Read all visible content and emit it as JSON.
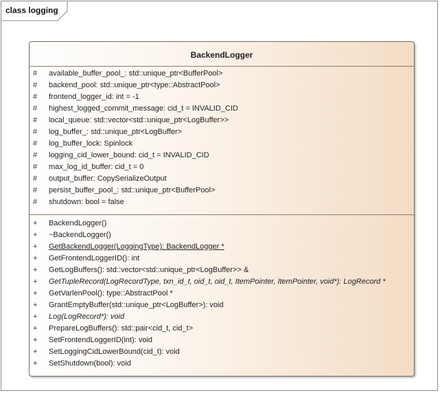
{
  "frame": {
    "title": "class logging"
  },
  "class_box": {
    "name": "BackendLogger",
    "attributes": [
      {
        "vis": "#",
        "text": "available_buffer_pool_: std::unique_ptr<BufferPool>"
      },
      {
        "vis": "#",
        "text": "backend_pool: std::unique_ptr<type::AbstractPool>"
      },
      {
        "vis": "#",
        "text": "frontend_logger_id: int = -1"
      },
      {
        "vis": "#",
        "text": "highest_logged_commit_message: cid_t = INVALID_CID"
      },
      {
        "vis": "#",
        "text": "local_queue: std::vector<std::unique_ptr<LogBuffer>>"
      },
      {
        "vis": "#",
        "text": "log_buffer_: std::unique_ptr<LogBuffer>"
      },
      {
        "vis": "#",
        "text": "log_buffer_lock: Spinlock"
      },
      {
        "vis": "#",
        "text": "logging_cid_lower_bound: cid_t = INVALID_CID"
      },
      {
        "vis": "#",
        "text": "max_log_id_buffer: cid_t = 0"
      },
      {
        "vis": "#",
        "text": "output_buffer: CopySerializeOutput"
      },
      {
        "vis": "#",
        "text": "persist_buffer_pool_: std::unique_ptr<BufferPool>"
      },
      {
        "vis": "#",
        "text": "shutdown: bool = false"
      }
    ],
    "operations": [
      {
        "vis": "+",
        "text": "BackendLogger()"
      },
      {
        "vis": "+",
        "text": "~BackendLogger()"
      },
      {
        "vis": "+",
        "text": "GetBackendLogger(LoggingType): BackendLogger *",
        "style": "underline"
      },
      {
        "vis": "+",
        "text": "GetFrontendLoggerID(): int"
      },
      {
        "vis": "+",
        "text": "GetLogBuffers(): std::vector<std::unique_ptr<LogBuffer>> &"
      },
      {
        "vis": "+",
        "text": "GetTupleRecord(LogRecordType, txn_id_t, oid_t, oid_t, ItemPointer, ItemPointer, void*): LogRecord *",
        "style": "italic"
      },
      {
        "vis": "+",
        "text": "GetVarlenPool(): type::AbstractPool *"
      },
      {
        "vis": "+",
        "text": "GrantEmptyBuffer(std::unique_ptr<LogBuffer>): void"
      },
      {
        "vis": "+",
        "text": "Log(LogRecord*): void",
        "style": "italic"
      },
      {
        "vis": "+",
        "text": "PrepareLogBuffers(): std::pair<cid_t, cid_t>"
      },
      {
        "vis": "+",
        "text": "SetFrontendLoggerID(int): void"
      },
      {
        "vis": "+",
        "text": "SetLoggingCidLowerBound(cid_t): void"
      },
      {
        "vis": "+",
        "text": "SetShutdown(bool): void"
      }
    ]
  }
}
